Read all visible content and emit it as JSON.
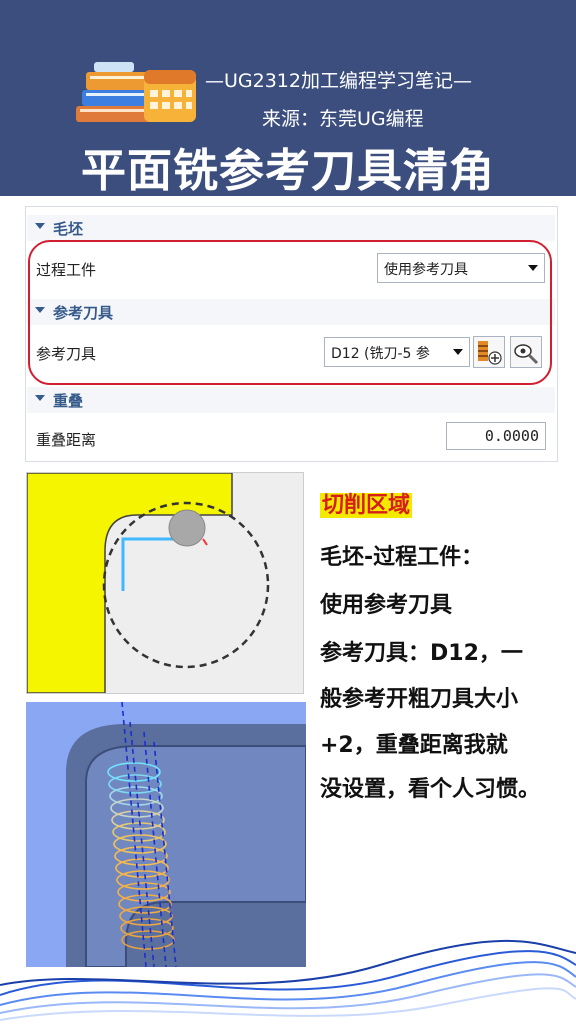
{
  "header": {
    "subtitle1": "—UG2312加工编程学习笔记—",
    "subtitle2": "来源：东莞UG编程",
    "title": "平面铣参考刀具清角"
  },
  "panel": {
    "blank_section": {
      "title": "毛坯",
      "row_label": "过程工件",
      "select_value": "使用参考刀具"
    },
    "ref_tool_section": {
      "title": "参考刀具",
      "row_label": "参考刀具",
      "select_value": "D12 (铣刀-5 参",
      "icons": [
        "new-tool-icon",
        "display-tool-icon"
      ]
    },
    "overlap_section": {
      "title": "重叠",
      "row_label": "重叠距离",
      "value": "0.0000"
    }
  },
  "notes": {
    "heading": "切削区域",
    "lines": [
      "毛坯-过程工件：",
      "使用参考刀具",
      "参考刀具：D12，一",
      "般参考开粗刀具大小",
      "+2，重叠距离我就",
      "没设置，看个人习惯。"
    ]
  },
  "colors": {
    "header_bg": "#3b4e7e",
    "highlight_red_box": "#d02030",
    "heading_highlight": "#f4ea00",
    "heading_text": "#d81b1b",
    "section_text": "#365a8a"
  }
}
